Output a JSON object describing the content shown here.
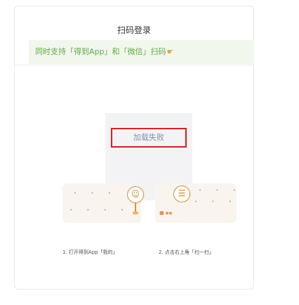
{
  "login": {
    "title": "扫码登录",
    "support_text": "同时支持「得到App」和「微信」扫码",
    "support_icon": "hand-pointer-icon",
    "qr": {
      "status_text": "加载失败"
    }
  },
  "steps": [
    {
      "caption": "1. 打开得到App「我的」"
    },
    {
      "caption": "2. 点击右上角「扫一扫」"
    }
  ],
  "colors": {
    "accent_green": "#5fb042",
    "banner_bg": "#f1f7ec",
    "error_border": "#e01e1e",
    "step_orange": "#f08a30"
  }
}
